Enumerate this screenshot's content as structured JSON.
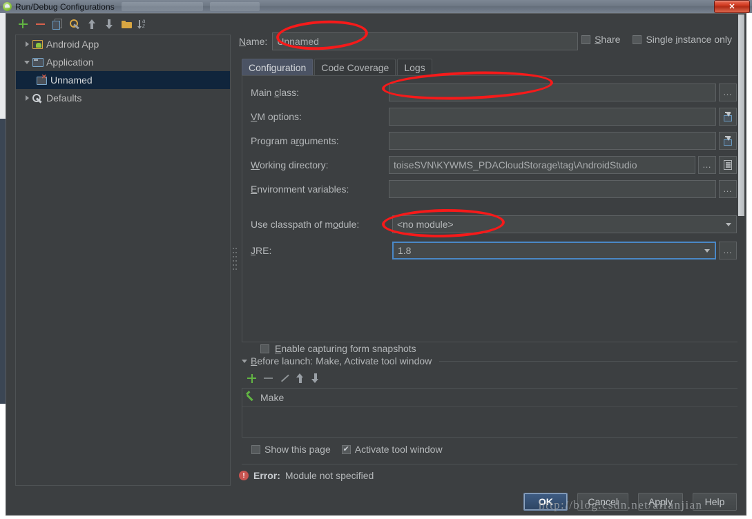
{
  "window": {
    "title": "Run/Debug Configurations",
    "app_icon": "android-studio-icon",
    "close_label": "✕"
  },
  "left_panel": {
    "toolbar": [
      {
        "name": "add",
        "icon": "plus-icon"
      },
      {
        "name": "remove",
        "icon": "minus-icon"
      },
      {
        "name": "copy",
        "icon": "copy-icon"
      },
      {
        "name": "edit-defaults",
        "icon": "wrench-icon"
      },
      {
        "name": "move-up",
        "icon": "arrow-up-icon"
      },
      {
        "name": "move-down",
        "icon": "arrow-down-icon"
      },
      {
        "name": "create-folder",
        "icon": "folder-icon"
      },
      {
        "name": "sort",
        "icon": "sort-alpha-icon"
      }
    ],
    "tree": [
      {
        "label": "Android App",
        "icon": "android-app-icon",
        "expander": "right",
        "indent": 0,
        "selected": false
      },
      {
        "label": "Application",
        "icon": "application-icon",
        "expander": "down",
        "indent": 0,
        "selected": false
      },
      {
        "label": "Unnamed",
        "icon": "application-error-icon",
        "expander": "none",
        "indent": 1,
        "selected": true
      },
      {
        "label": "Defaults",
        "icon": "defaults-icon",
        "expander": "right",
        "indent": 0,
        "selected": false
      }
    ]
  },
  "main": {
    "name_label_pre": "N",
    "name_label_post": "ame:",
    "name_value": "Unnamed",
    "share": {
      "label_pre": "S",
      "label_post": "hare",
      "checked": false
    },
    "single_instance": {
      "label_pre": "Single ",
      "label_mid": "i",
      "label_post": "nstance only",
      "checked": false
    },
    "tabs": [
      {
        "label": "Configuration",
        "active": true
      },
      {
        "label": "Code Coverage",
        "active": false
      },
      {
        "label": "Logs",
        "active": false
      }
    ],
    "fields": [
      {
        "name": "main-class",
        "label_pre": "Main ",
        "label_mid": "c",
        "label_post": "lass:",
        "value": "",
        "buttons": [
          "dots-icon"
        ]
      },
      {
        "name": "vm-options",
        "label_pre": "",
        "label_mid": "V",
        "label_post": "M options:",
        "value": "",
        "buttons": [
          "expand-icon"
        ]
      },
      {
        "name": "program-arguments",
        "label_pre": "Program a",
        "label_mid": "r",
        "label_post": "guments:",
        "value": "",
        "buttons": [
          "expand-icon"
        ]
      },
      {
        "name": "working-directory",
        "label_pre": "",
        "label_mid": "W",
        "label_post": "orking directory:",
        "value": "toiseSVN\\KYWMS_PDACloudStorage\\tag\\AndroidStudio",
        "buttons": [
          "dots-icon",
          "list-icon"
        ]
      },
      {
        "name": "environment-variables",
        "label_pre": "",
        "label_mid": "E",
        "label_post": "nvironment variables:",
        "value": "",
        "buttons": [
          "dots-icon"
        ]
      }
    ],
    "module_combo": {
      "label_pre": "Use classpath of m",
      "label_mid": "o",
      "label_post": "dule:",
      "value": "<no module>"
    },
    "jre_combo": {
      "label_pre": "",
      "label_mid": "J",
      "label_post": "RE:",
      "value": "1.8",
      "focused": true,
      "buttons": [
        "dots-icon"
      ]
    },
    "form_snapshots": {
      "label_pre": "",
      "label_mid": "E",
      "label_post": "nable capturing form snapshots",
      "checked": false
    },
    "before_launch": {
      "title_pre": "",
      "title_mid": "B",
      "title_post": "efore launch: Make, Activate tool window",
      "toolbar": [
        {
          "name": "add-task",
          "icon": "plus-icon"
        },
        {
          "name": "remove-task",
          "icon": "minus-icon"
        },
        {
          "name": "edit-task",
          "icon": "pencil-icon"
        },
        {
          "name": "task-move-up",
          "icon": "arrow-up-icon"
        },
        {
          "name": "task-move-down",
          "icon": "arrow-down-icon"
        }
      ],
      "items": [
        {
          "label": "Make",
          "icon": "hammer-icon"
        }
      ]
    },
    "show_this_page": {
      "label": "Show this page",
      "checked": false
    },
    "activate_tool_window": {
      "label": "Activate tool window",
      "checked": true
    },
    "error": {
      "prefix": "Error:",
      "message": "Module not specified",
      "icon": "error-icon"
    }
  },
  "buttons": [
    {
      "label": "OK",
      "primary": true
    },
    {
      "label": "Cancel",
      "primary": false
    },
    {
      "label": "Apply",
      "primary": false
    },
    {
      "label": "Help",
      "primary": false
    }
  ],
  "watermark": "http://blog.csdn.net/aifanjian",
  "colors": {
    "background": "#3c3f41",
    "field": "#45494a",
    "selection": "#10253c",
    "accent": "#4a88c7",
    "annotation": "#f61a1a",
    "error": "#c75450",
    "green": "#62b543"
  }
}
